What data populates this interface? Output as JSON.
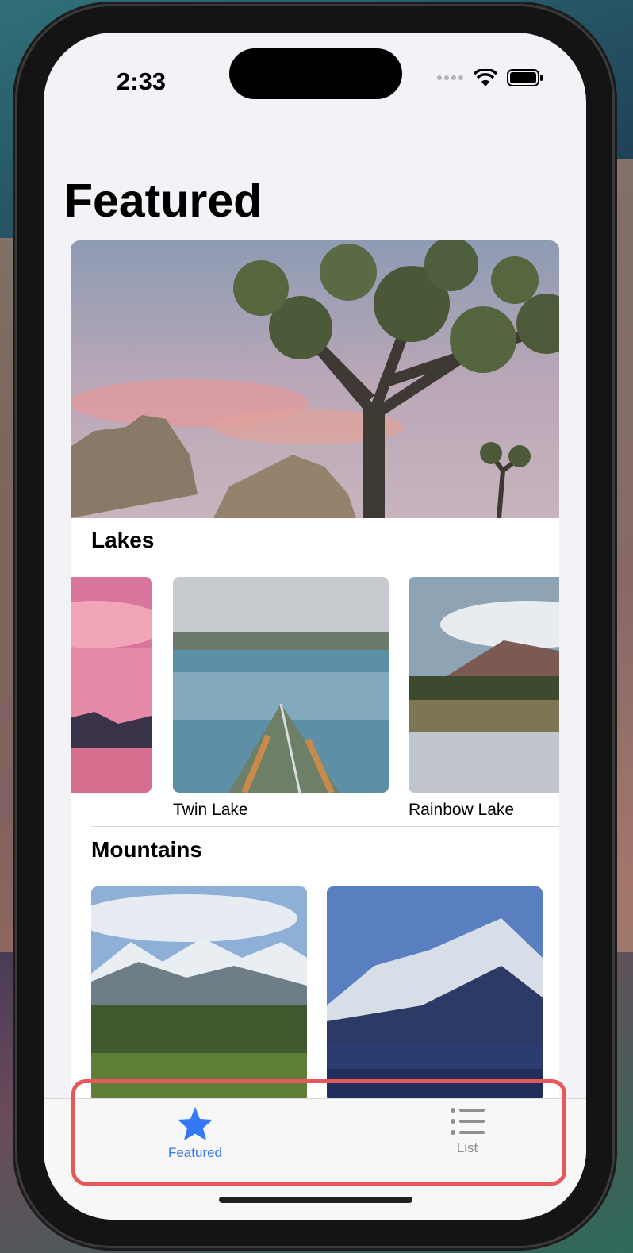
{
  "status_bar": {
    "time": "2:33"
  },
  "header": {
    "title": "Featured"
  },
  "sections": [
    {
      "title": "Lakes",
      "items": [
        {
          "caption": ""
        },
        {
          "caption": "Twin Lake"
        },
        {
          "caption": "Rainbow Lake"
        }
      ]
    },
    {
      "title": "Mountains",
      "items": [
        {
          "caption": ""
        },
        {
          "caption": ""
        }
      ]
    }
  ],
  "tabbar": {
    "tabs": [
      {
        "label": "Featured",
        "icon": "star-icon",
        "selected": true
      },
      {
        "label": "List",
        "icon": "list-icon",
        "selected": false
      }
    ]
  },
  "colors": {
    "accent": "#3478f6",
    "inactive": "#8e8e93",
    "highlight": "#e8585a"
  }
}
